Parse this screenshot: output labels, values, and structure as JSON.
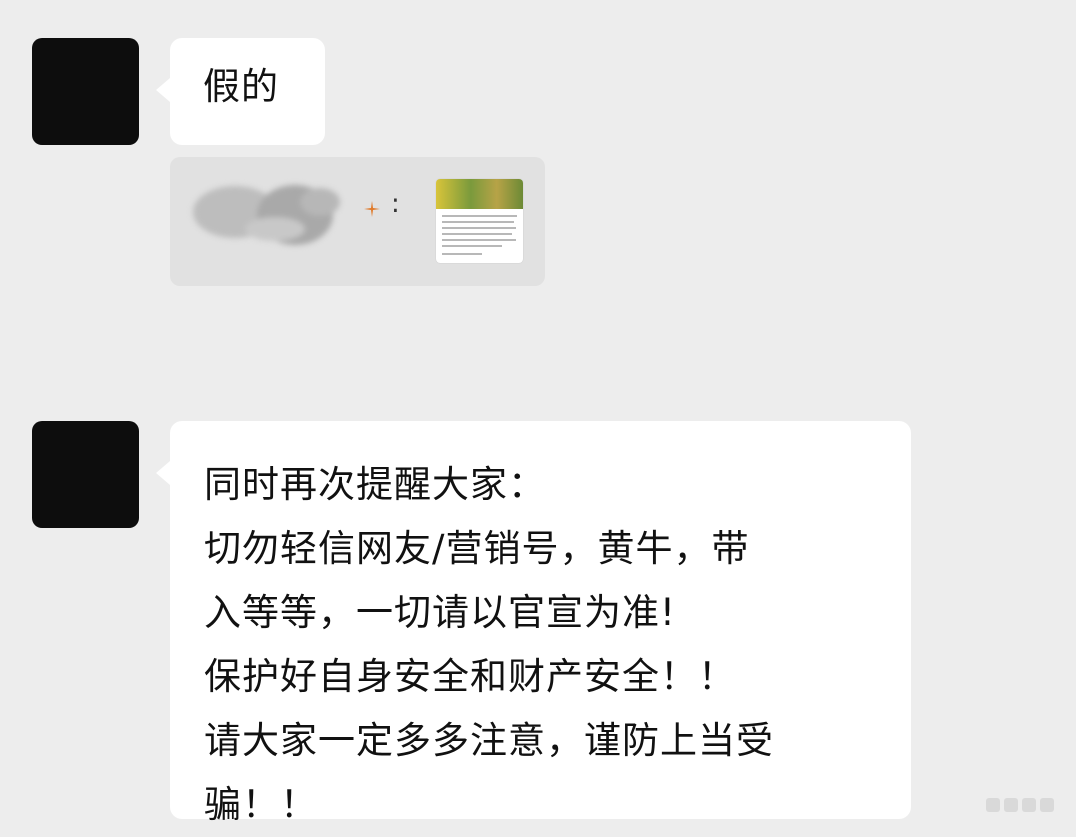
{
  "messages": [
    {
      "type": "text",
      "text": "假的"
    },
    {
      "type": "quote",
      "separator": ":"
    },
    {
      "type": "text",
      "lines": [
        "同时再次提醒大家：",
        "切勿轻信网友/营销号，黄牛，带",
        "入等等，一切请以官宣为准!",
        "保护好自身安全和财产安全！！",
        "请大家一定多多注意，谨防上当受",
        "骗！！"
      ]
    }
  ],
  "colors": {
    "background": "#ededed",
    "bubble": "#ffffff",
    "avatar": "#0d0d0d",
    "quote_background": "#e1e1e1"
  }
}
